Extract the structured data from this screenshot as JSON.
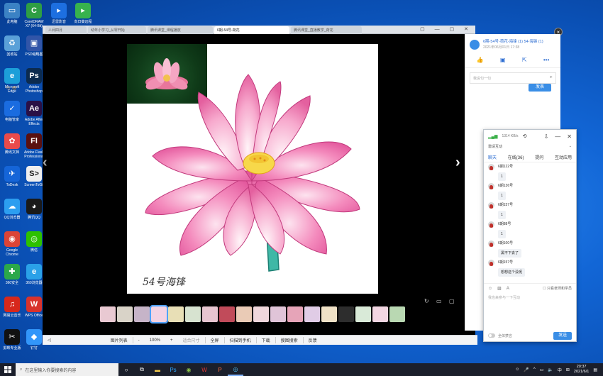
{
  "desktop_icons": [
    {
      "label": "此电脑",
      "icon": "computer-icon",
      "color": "#3b82c4",
      "glyph": "▭"
    },
    {
      "label": "回收站",
      "icon": "recycle-bin-icon",
      "color": "#5aa0d8",
      "glyph": "♻"
    },
    {
      "label": "Microsoft Edge",
      "icon": "edge-icon",
      "color": "#1c9fd9",
      "glyph": "e"
    },
    {
      "label": "电脑管家",
      "icon": "pc-manager-icon",
      "color": "#1a6ce0",
      "glyph": "✓"
    },
    {
      "label": "腾讯文档",
      "icon": "tencent-docs-icon",
      "color": "#e94b4b",
      "glyph": "✿"
    },
    {
      "label": "ToDesk",
      "icon": "todesk-icon",
      "color": "#1565d8",
      "glyph": "✈"
    },
    {
      "label": "QQ浏览器",
      "icon": "qq-browser-icon",
      "color": "#2c9ef0",
      "glyph": "☁"
    },
    {
      "label": "Google Chrome",
      "icon": "chrome-icon",
      "color": "#db4437",
      "glyph": "◉"
    },
    {
      "label": "360安全",
      "icon": "security360-icon",
      "color": "#2ba84a",
      "glyph": "✚"
    },
    {
      "label": "网易云音乐",
      "icon": "netease-music-icon",
      "color": "#d7281c",
      "glyph": "♫"
    },
    {
      "label": "剪映专业版",
      "icon": "capcut-icon",
      "color": "#111111",
      "glyph": "✂"
    },
    {
      "label": "CorelDRAW X7 (64-Bit)",
      "icon": "coreldraw-icon",
      "color": "#2e9e44",
      "glyph": "C"
    },
    {
      "label": "PSD缩略图",
      "icon": "psd-thumb-icon",
      "color": "#3155a8",
      "glyph": "▣"
    },
    {
      "label": "Adobe Photoshop",
      "icon": "photoshop-icon",
      "color": "#0c2b4f",
      "glyph": "Ps"
    },
    {
      "label": "Adobe After Effects",
      "icon": "aftereffects-icon",
      "color": "#2a1046",
      "glyph": "Ae"
    },
    {
      "label": "Adobe Flash Professional",
      "icon": "flash-icon",
      "color": "#5a1010",
      "glyph": "Fl"
    },
    {
      "label": "ScreenToGif",
      "icon": "screentogif-icon",
      "color": "#eeeeee",
      "glyph": "S>"
    },
    {
      "label": "腾讯QQ",
      "icon": "qq-icon",
      "color": "#1a1a1a",
      "glyph": "◕"
    },
    {
      "label": "微信",
      "icon": "wechat-icon",
      "color": "#2dc100",
      "glyph": "◎"
    },
    {
      "label": "360浏览器",
      "icon": "browser360-icon",
      "color": "#2aa1e8",
      "glyph": "e"
    },
    {
      "label": "WPS Office",
      "icon": "wps-icon",
      "color": "#d8322c",
      "glyph": "W"
    },
    {
      "label": "钉钉",
      "icon": "dingtalk-icon",
      "color": "#3296fa",
      "glyph": "◆"
    }
  ],
  "top_apps": [
    {
      "label": "迅雷影音",
      "icon": "xunlei-icon",
      "color": "#1d6fe0"
    },
    {
      "label": "向日葵远程",
      "icon": "sunflower-icon",
      "color": "#37b24d"
    }
  ],
  "browser": {
    "tabs": [
      "人间四月",
      "幼年小学习_从零开始",
      "腾讯课堂_课程播放",
      "6期-54号-荷花",
      "腾讯课堂_直播教学_荷花"
    ],
    "active_tab": 3
  },
  "viewer": {
    "watermark": "54号海锋",
    "bottom_bar": [
      "图片列表",
      "-",
      "100%",
      "+",
      "适合尺寸",
      "全屏",
      "扫描到手机",
      "下载",
      "搜图搜索",
      "反馈"
    ]
  },
  "blog": {
    "title": "6期-54号-荷花-海锋 (1) 54-海锋 (1)",
    "date": "2021年06月01日 17:38",
    "comment_placeholder": "我说句一句",
    "send_label": "发表"
  },
  "chat": {
    "signal": "1314 KB/s",
    "select_label": "邀请互动",
    "tabs": [
      "聊天",
      "在线(36)",
      "提问",
      "互动应用"
    ],
    "messages": [
      {
        "name": "6期122号",
        "text": "1"
      },
      {
        "name": "6期136号",
        "text": "1"
      },
      {
        "name": "6期157号",
        "text": "1"
      },
      {
        "name": "6期88号",
        "text": "1"
      },
      {
        "name": "6期100号",
        "text": "黑不下去了"
      },
      {
        "name": "6期157号",
        "text": "想想这个没呢"
      }
    ],
    "only_teacher": "只看老师和学员",
    "input_placeholder": "我也来参与一下互动",
    "mute_label": "全体禁言",
    "send_label": "发送"
  },
  "taskbar": {
    "search_placeholder": "在这里输入你要搜索的内容",
    "time": "20:37",
    "date": "2021/6/1",
    "ime": "中"
  }
}
